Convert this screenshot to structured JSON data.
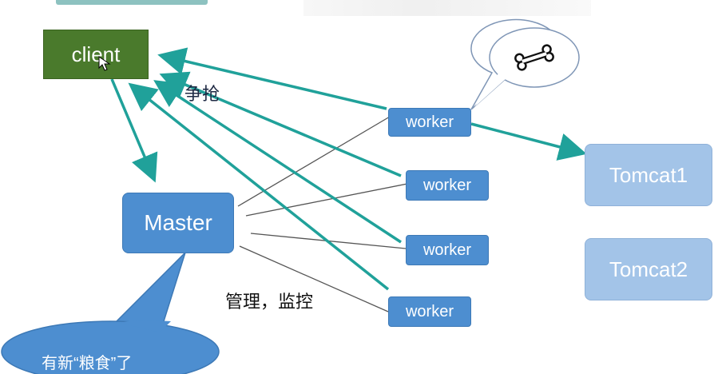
{
  "nodes": {
    "client": "client",
    "master": "Master",
    "worker1": "worker",
    "worker2": "worker",
    "worker3": "worker",
    "worker4": "worker",
    "tomcat1": "Tomcat1",
    "tomcat2": "Tomcat2"
  },
  "labels": {
    "compete": "争抢",
    "manage": "管理，监控",
    "callout": "有新“粮食”了"
  },
  "colors": {
    "arrow": "#20a19a",
    "node_blue": "#4d8ed0",
    "tomcat": "#a3c4e8",
    "client": "#4a7a2c"
  },
  "icons": {
    "speech_bubble_content": "bone-icon"
  }
}
